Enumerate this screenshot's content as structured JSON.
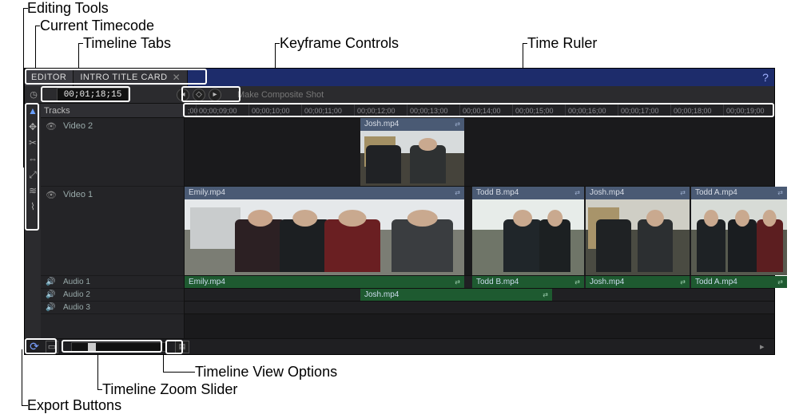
{
  "annotations": {
    "editing_tools": "Editing Tools",
    "current_timecode": "Current Timecode",
    "timeline_tabs": "Timeline Tabs",
    "keyframe_controls": "Keyframe Controls",
    "time_ruler": "Time Ruler",
    "timeline_view_options": "Timeline View Options",
    "timeline_zoom_slider": "Timeline Zoom Slider",
    "export_buttons": "Export Buttons"
  },
  "tabs": [
    {
      "label": "EDITOR",
      "active": true,
      "closable": false
    },
    {
      "label": "INTRO TITLE CARD",
      "active": false,
      "closable": true
    }
  ],
  "timecode": "00;01;18;15",
  "toprow_label": "Make Composite Shot",
  "tracks_header": "Tracks",
  "ruler_start": ";00",
  "ruler_ticks": [
    "00;00;09;00",
    "00;00;10;00",
    "00;00;11;00",
    "00;00;12;00",
    "00;00;13;00",
    "00;00;14;00",
    "00;00;15;00",
    "00;00;16;00",
    "00;00;17;00",
    "00;00;18;00",
    "00;00;19;00"
  ],
  "tracks": {
    "video2": {
      "label": "Video 2"
    },
    "video1": {
      "label": "Video 1"
    },
    "audio1": {
      "label": "Audio 1"
    },
    "audio2": {
      "label": "Audio 2"
    },
    "audio3": {
      "label": "Audio 3"
    }
  },
  "clips": {
    "v2_josh": {
      "label": "Josh.mp4"
    },
    "v1_emily": {
      "label": "Emily.mp4"
    },
    "v1_toddb": {
      "label": "Todd B.mp4"
    },
    "v1_josh": {
      "label": "Josh.mp4"
    },
    "v1_todda": {
      "label": "Todd A.mp4"
    },
    "a1_emily": {
      "label": "Emily.mp4"
    },
    "a1_toddb": {
      "label": "Todd B.mp4"
    },
    "a1_josh": {
      "label": "Josh.mp4"
    },
    "a1_todda": {
      "label": "Todd A.mp4"
    },
    "a2_josh": {
      "label": "Josh.mp4"
    }
  },
  "icons": {
    "link": "⇄"
  }
}
